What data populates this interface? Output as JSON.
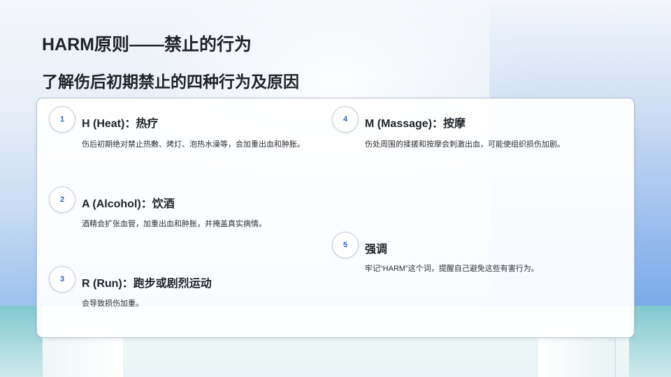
{
  "slide": {
    "title": "HARM原则——禁止的行为",
    "subtitle": "了解伤后初期禁止的四种行为及原因"
  },
  "items": [
    {
      "number": "1",
      "heading": "H (Heat)：热疗",
      "description": "伤后初期绝对禁止热敷、烤灯、泡热水澡等，会加重出血和肿胀。"
    },
    {
      "number": "2",
      "heading": "A (Alcohol)：饮酒",
      "description": "酒精会扩张血管，加重出血和肿胀，并掩盖真实病情。"
    },
    {
      "number": "3",
      "heading": "R (Run)：跑步或剧烈运动",
      "description": "会导致损伤加重。"
    },
    {
      "number": "4",
      "heading": "M (Massage)：按摩",
      "description": "伤处周围的揉搓和按摩会刺激出血，可能使组织损伤加剧。"
    },
    {
      "number": "5",
      "heading": "强调",
      "description": "牢记“HARM”这个词，提醒自己避免这些有害行为。"
    }
  ]
}
